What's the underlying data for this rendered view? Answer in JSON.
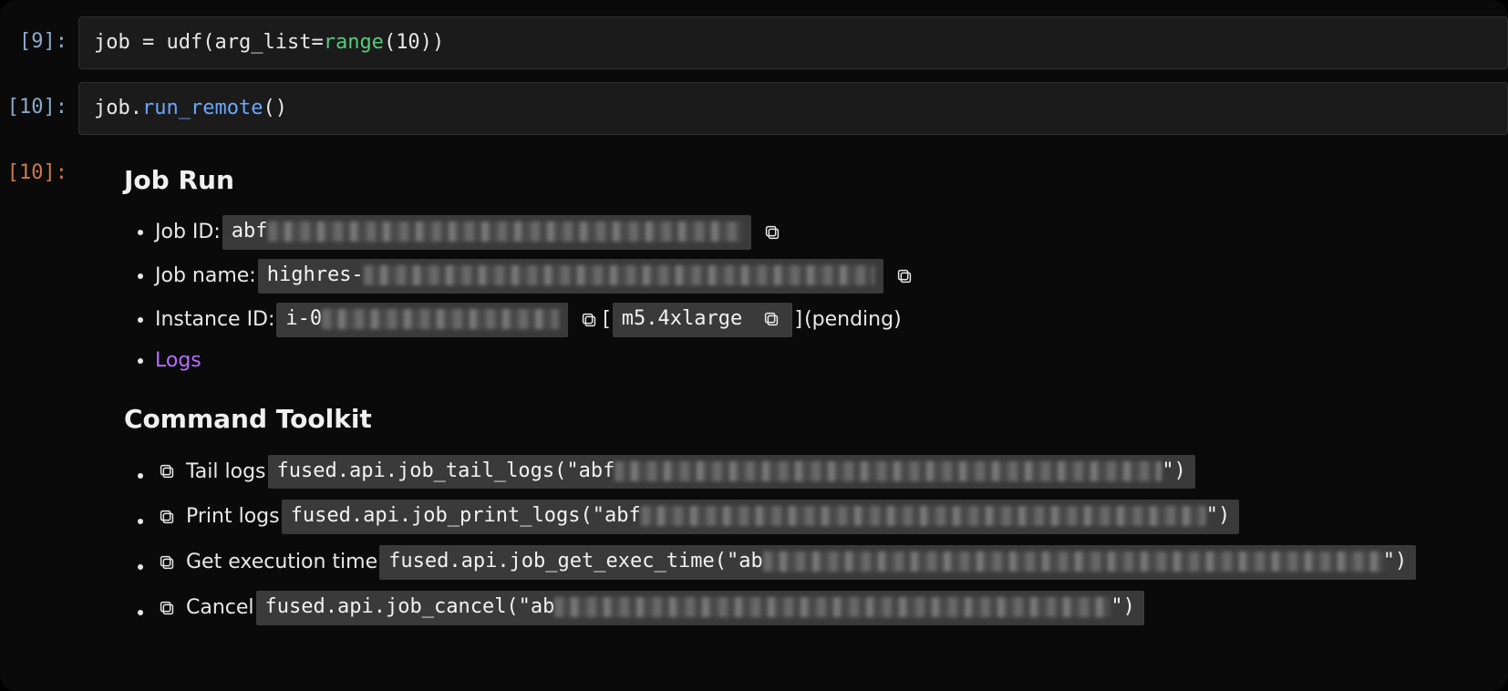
{
  "cells": {
    "c9": {
      "prompt": "[9]:",
      "code": {
        "s1": "job ",
        "eq": "= ",
        "fn": "udf",
        "lp": "(",
        "arg": "arg_list",
        "eq2": "=",
        "rng": "range",
        "lp2": "(",
        "ten": "10",
        "rp2": ")",
        "rp": ")"
      }
    },
    "c10": {
      "prompt": "[10]:",
      "code": {
        "obj": "job",
        "dot": ".",
        "method": "run_remote",
        "lp": "(",
        "rp": ")"
      }
    },
    "out10": {
      "prompt": "[10]:"
    }
  },
  "jobrun": {
    "heading": "Job Run",
    "jobid_label": "Job ID: ",
    "jobid_prefix": "abf",
    "jobname_label": "Job name: ",
    "jobname_prefix": "highres-",
    "instance_label": "Instance ID: ",
    "instance_prefix": "i-0",
    "instance_type": "m5.4xlarge",
    "instance_status": " (pending)",
    "bracket_open": " [ ",
    "bracket_close": " ] ",
    "logs_label": "Logs"
  },
  "toolkit": {
    "heading": "Command Toolkit",
    "tail_label": "Tail logs ",
    "tail_code_prefix": "fused.api.job_tail_logs(\"abf",
    "tail_code_suffix": "\")",
    "print_label": "Print logs ",
    "print_code_prefix": "fused.api.job_print_logs(\"abf",
    "print_code_suffix": "\")",
    "exec_label": "Get execution time ",
    "exec_code_prefix": "fused.api.job_get_exec_time(\"ab",
    "exec_code_suffix": "\")",
    "cancel_label": "Cancel ",
    "cancel_code_prefix": "fused.api.job_cancel(\"ab",
    "cancel_code_suffix": "\")"
  }
}
